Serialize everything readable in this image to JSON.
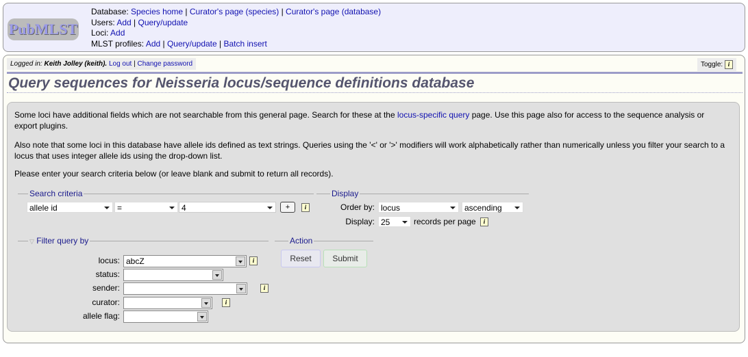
{
  "header": {
    "logo": "PubMLST",
    "database_label": "Database:",
    "species_home": "Species home",
    "curators_species": "Curator's page (species)",
    "curators_database": "Curator's page (database)",
    "users_label": "Users:",
    "users_add": "Add",
    "users_query": "Query/update",
    "loci_label": "Loci:",
    "loci_add": "Add",
    "mlst_label": "MLST profiles:",
    "mlst_add": "Add",
    "mlst_query": "Query/update",
    "mlst_batch": "Batch insert"
  },
  "login": {
    "prefix": "Logged in:",
    "user": "Keith Jolley (keith).",
    "logout": "Log out",
    "change_password": "Change password"
  },
  "toggle": "Toggle:",
  "title": "Query sequences for Neisseria locus/sequence definitions database",
  "intro": {
    "p1_a": "Some loci have additional fields which are not searchable from this general page. Search for these at the ",
    "p1_link": "locus-specific query",
    "p1_b": " page. Use this page also for access to the sequence analysis or export plugins.",
    "p2": "Also note that some loci in this database have allele ids defined as text strings. Queries using the '<' or '>' modifiers will work alphabetically rather than numerically unless you filter your search to a locus that uses integer allele ids using the drop-down list.",
    "p3": "Please enter your search criteria below (or leave blank and submit to return all records)."
  },
  "search": {
    "legend": "Search criteria",
    "field": "allele id",
    "operator": "=",
    "value": "4",
    "add": "+"
  },
  "display": {
    "legend": "Display",
    "order_label": "Order by:",
    "order": "locus",
    "direction": "ascending",
    "display_label": "Display:",
    "per_page": "25",
    "per_page_suffix": "records per page"
  },
  "filter": {
    "legend": "Filter query by",
    "locus_label": "locus:",
    "locus": "abcZ",
    "status_label": "status:",
    "sender_label": "sender:",
    "curator_label": "curator:",
    "flag_label": "allele flag:"
  },
  "action": {
    "legend": "Action",
    "reset": "Reset",
    "submit": "Submit"
  }
}
